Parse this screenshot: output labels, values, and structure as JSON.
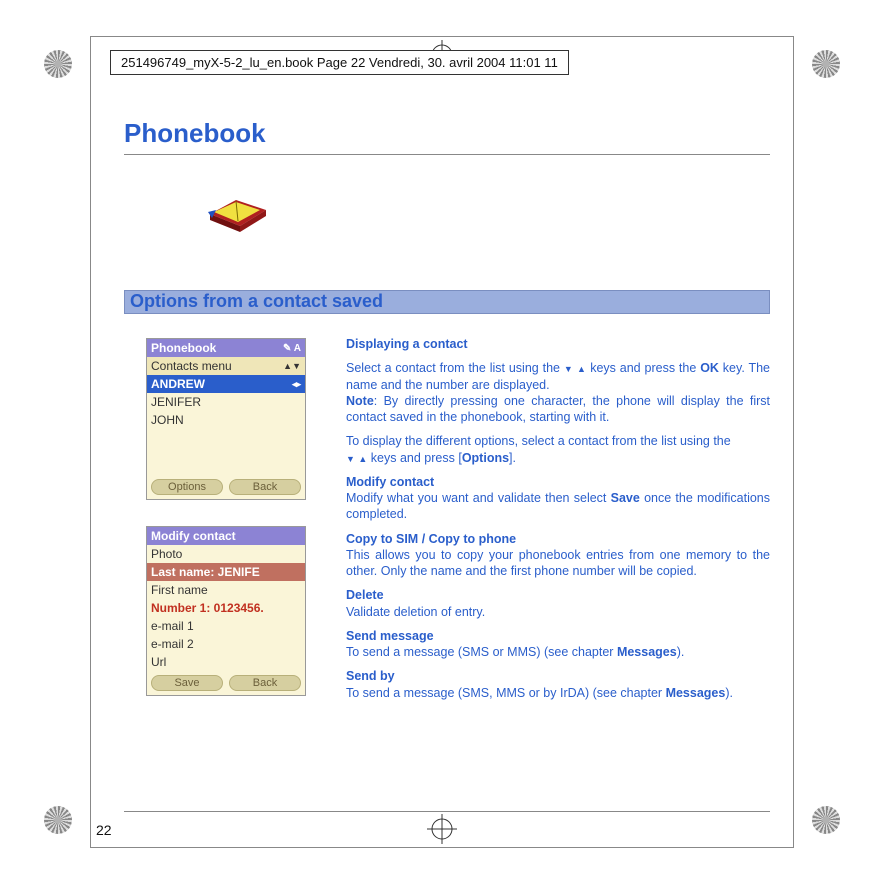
{
  "header": {
    "text": "251496749_myX-5-2_lu_en.book  Page 22  Vendredi, 30. avril 2004  11:01 11"
  },
  "page_number": "22",
  "title": "Phonebook",
  "section_title": "Options from a contact saved",
  "screen1": {
    "titlebar_left": "Phonebook",
    "titlebar_right": "A",
    "menu": "Contacts menu",
    "items": [
      "ANDREW",
      "JENIFER",
      "JOHN"
    ],
    "soft_left": "Options",
    "soft_right": "Back"
  },
  "screen2": {
    "titlebar": "Modify contact",
    "fields": [
      "Photo",
      "Last name: JENIFE",
      "First name",
      "Number 1: 0123456.",
      "e-mail 1",
      "e-mail 2",
      "Url"
    ],
    "soft_left": "Save",
    "soft_right": "Back"
  },
  "body": {
    "h1": "Displaying a contact",
    "p1a": "Select a contact from the list using the ",
    "p1b": " keys and press the ",
    "p1ok": "OK",
    "p1c": " key. The name and the number are displayed.",
    "note_label": "Note",
    "note_text": ": By directly pressing one character, the phone will display the first contact saved in the phonebook, starting with it.",
    "p2a": "To display the different options, select a contact from the list using the ",
    "p2b": " keys and press [",
    "p2options": "Options",
    "p2c": "].",
    "h2": "Modify contact",
    "p3a": "Modify what you want and validate then select ",
    "p3save": "Save",
    "p3b": " once the modifications completed.",
    "h3": "Copy to SIM / Copy to phone",
    "p4": "This allows you to copy your phonebook entries from one memory to the other. Only the name and the first phone number will be copied.",
    "h4": "Delete",
    "p5": "Validate deletion of entry.",
    "h5": "Send message",
    "p6a": "To send a message (SMS or MMS) (see chapter ",
    "p6msg": "Messages",
    "p6b": ").",
    "h6": "Send by",
    "p7a": "To send a message (SMS, MMS or by IrDA) (see chapter ",
    "p7msg": "Messages",
    "p7b": ")."
  }
}
